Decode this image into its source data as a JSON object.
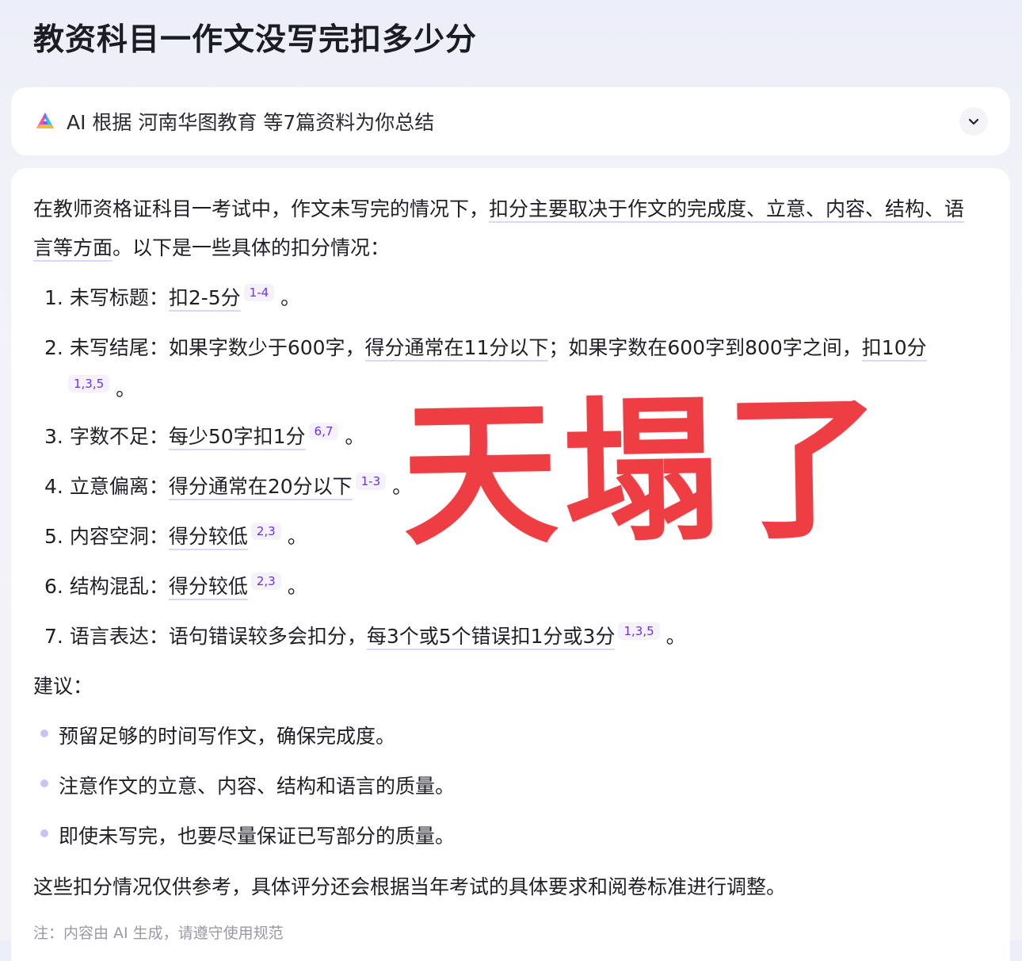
{
  "page": {
    "title": "教资科目一作文没写完扣多少分"
  },
  "summary_bar": {
    "text": "AI 根据 河南华图教育 等7篇资料为你总结",
    "logo_icon": "ai-logo-icon",
    "expand_icon": "chevron-down-icon"
  },
  "intro": {
    "part1": "在教师资格证科目一考试中，作文未写完的情况下，",
    "part2": "扣分主要取决于作文的完成度、立意、内容、结构、语言等方面",
    "part3": "。以下是一些具体的扣分情况："
  },
  "items": [
    {
      "num": "1.",
      "label": "未写标题：",
      "text": "扣2-5分",
      "cite": "1-4"
    },
    {
      "num": "2.",
      "label": "未写结尾：",
      "text1": "如果字数少于600字，",
      "text2": "得分通常在11分以下",
      "text3": "；如果字数在600字到800字之间，",
      "text4": "扣10分",
      "cite": "1,3,5"
    },
    {
      "num": "3.",
      "label": "字数不足：",
      "text": "每少50字扣1分",
      "cite": "6,7"
    },
    {
      "num": "4.",
      "label": "立意偏离：",
      "text": "得分通常在20分以下",
      "cite": "1-3"
    },
    {
      "num": "5.",
      "label": "内容空洞：",
      "text": "得分较低",
      "cite": "2,3"
    },
    {
      "num": "6.",
      "label": "结构混乱：",
      "text": "得分较低",
      "cite": "2,3"
    },
    {
      "num": "7.",
      "label": "语言表达：",
      "text1": "语句错误较多会扣分，",
      "text2": "每3个或5个错误扣1分或3分",
      "cite": "1,3,5"
    }
  ],
  "period": "。",
  "suggestions": {
    "title": "建议：",
    "bullets": [
      "预留足够的时间写作文，确保完成度。",
      "注意作文的立意、内容、结构和语言的质量。",
      "即使未写完，也要尽量保证已写部分的质量。"
    ]
  },
  "closing": "这些扣分情况仅供参考，具体评分还会根据当年考试的具体要求和阅卷标准进行调整。",
  "note": "注：内容由 AI 生成，请遵守使用规范",
  "overlay": {
    "text": "天塌了",
    "color": "#ee3d43"
  },
  "colors": {
    "citation_text": "#6a32f0",
    "citation_bg": "#f5f1ff",
    "underline": "#ddd6fb",
    "bullet": "#c9c3f5"
  }
}
